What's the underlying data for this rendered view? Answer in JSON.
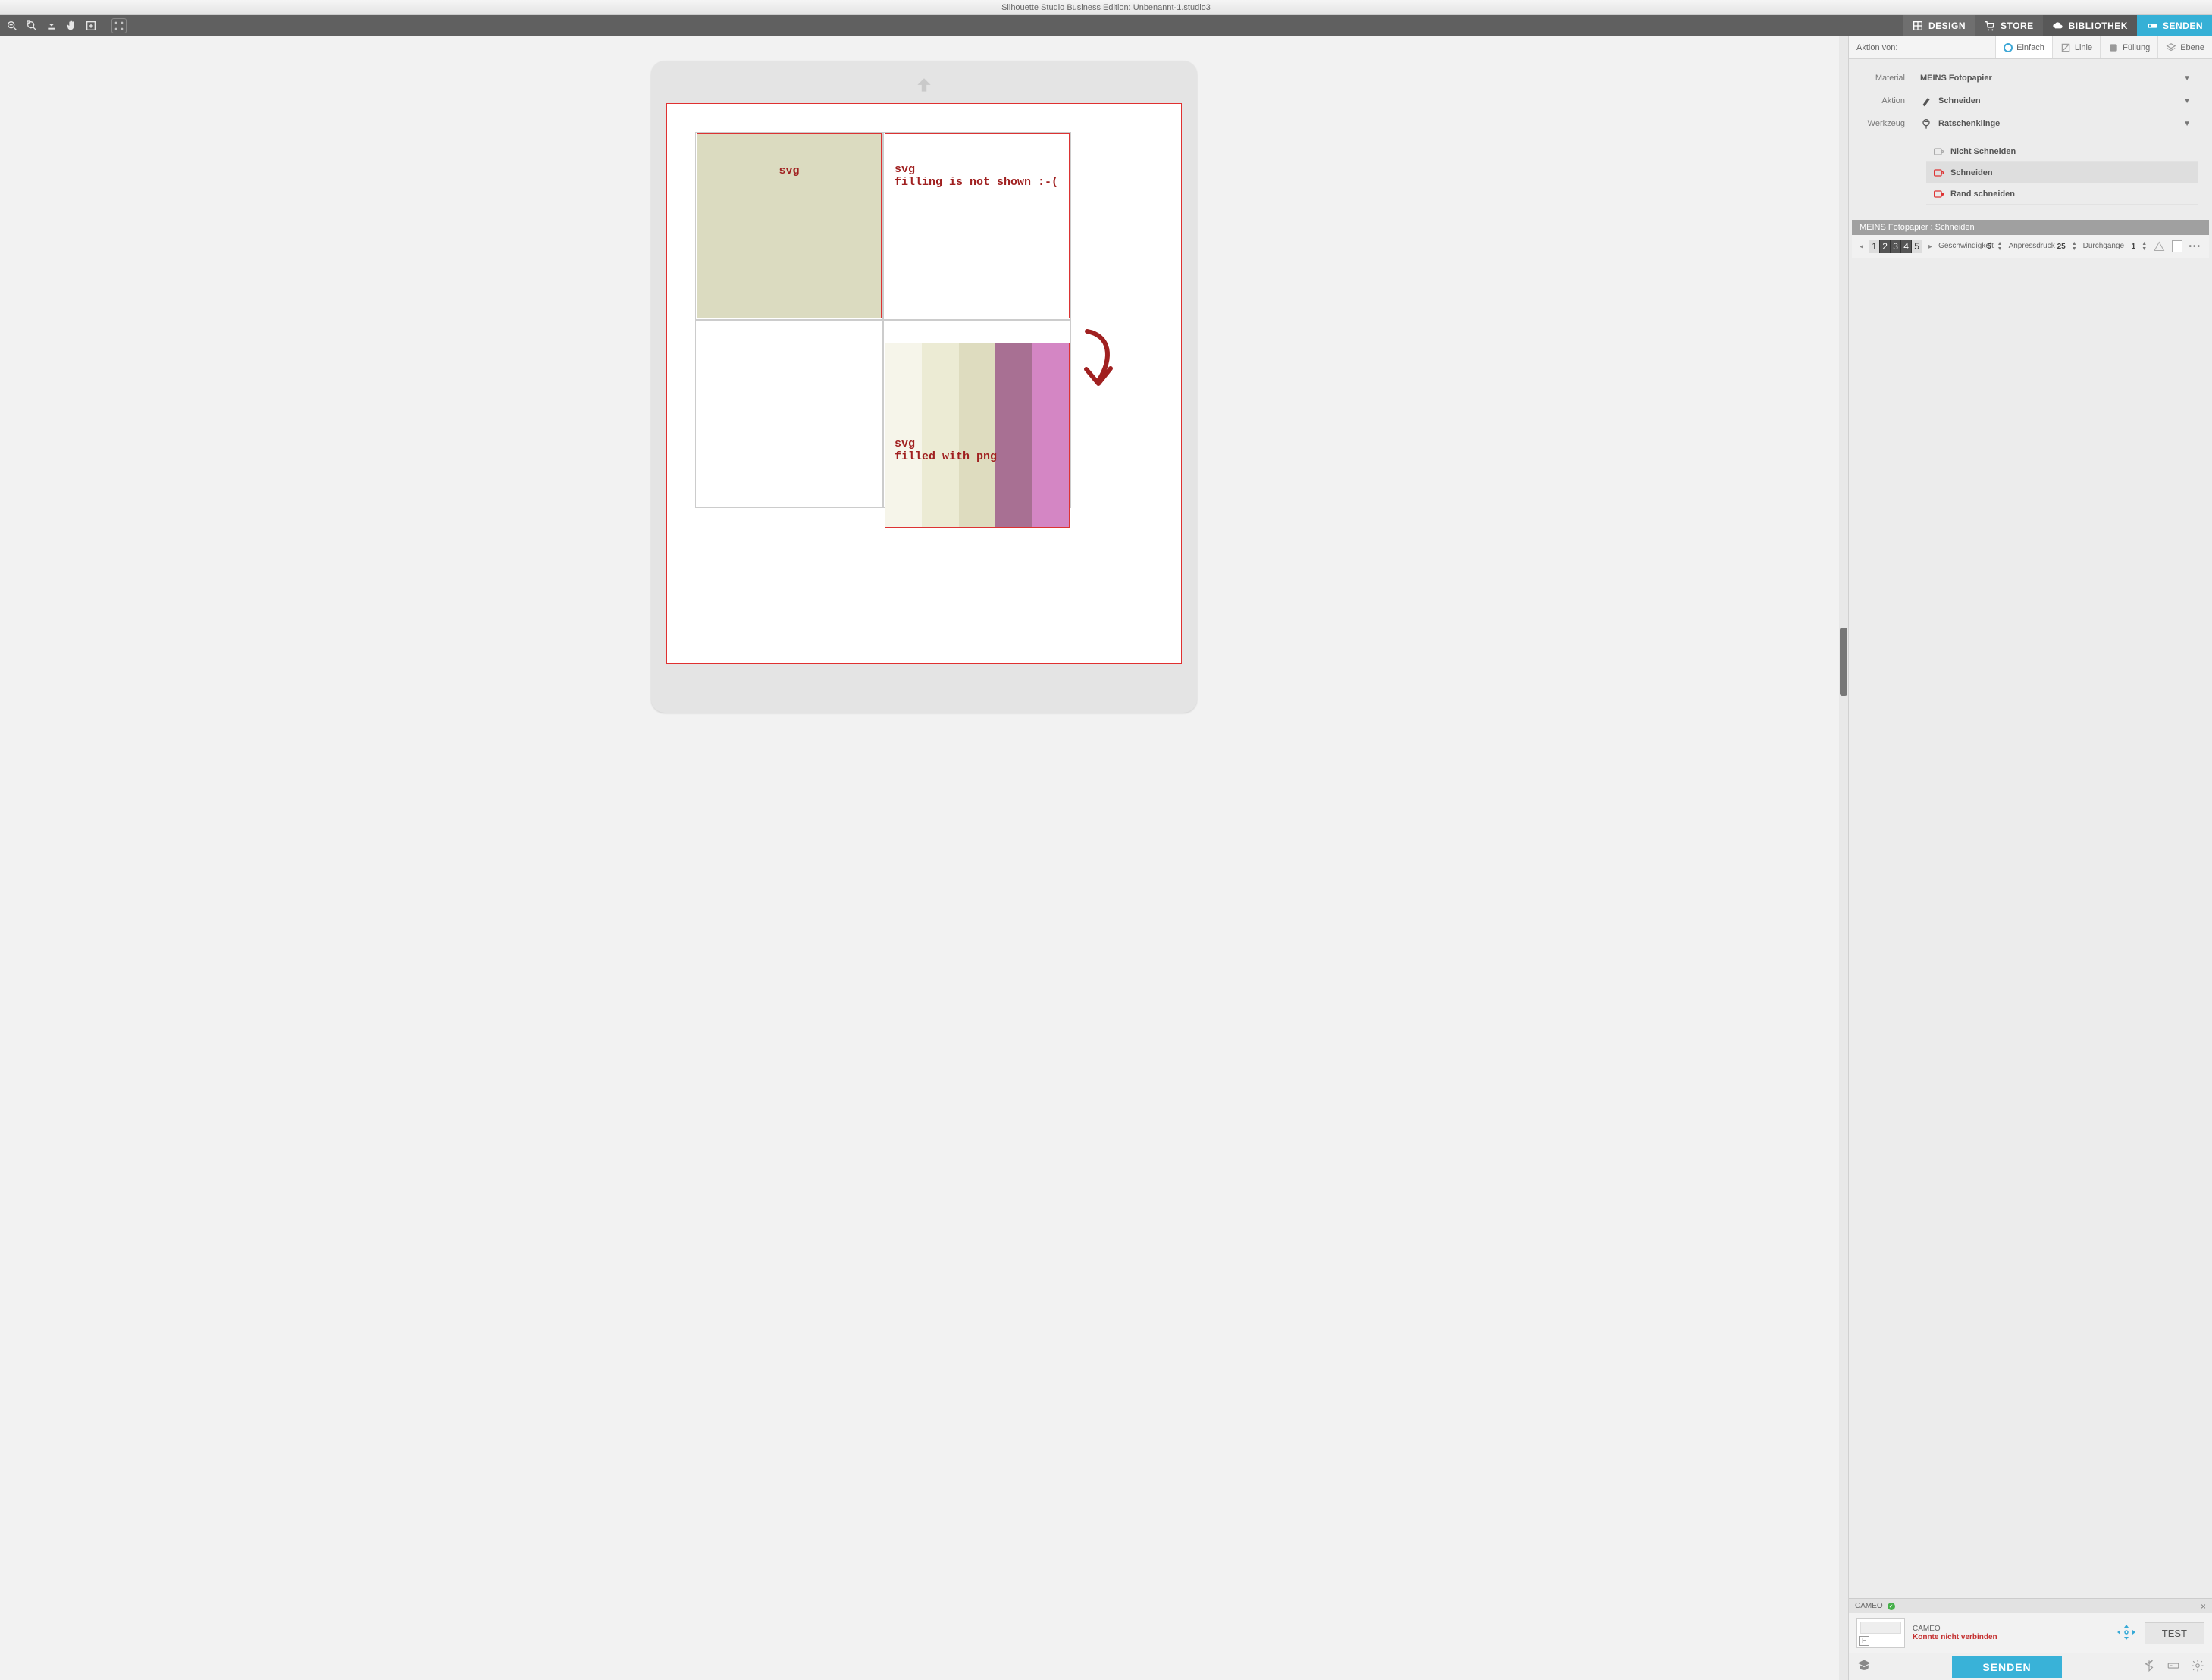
{
  "title": "Silhouette Studio Business Edition: Unbenannt-1.studio3",
  "nav": {
    "design": "DESIGN",
    "store": "STORE",
    "library": "BIBLIOTHEK",
    "send": "SENDEN"
  },
  "canvas": {
    "obj1": "svg",
    "obj2": "svg\nfilling is not shown :-(",
    "obj3": "svg\nfilled with png"
  },
  "panel": {
    "action_from": "Aktion von:",
    "tabs": {
      "simple": "Einfach",
      "line": "Linie",
      "fill": "Füllung",
      "layer": "Ebene"
    },
    "material_label": "Material",
    "material_value": "MEINS Fotopapier",
    "action_label": "Aktion",
    "action_value": "Schneiden",
    "tool_label": "Werkzeug",
    "tool_value": "Ratschenklinge",
    "opts": {
      "nocut": "Nicht Schneiden",
      "cut": "Schneiden",
      "edgecut": "Rand schneiden"
    },
    "section": "MEINS Fotopapier : Schneiden",
    "params": {
      "speed_label": "Geschwindigkeit",
      "speed_value": "5",
      "force_label": "Anpressdruck",
      "force_value": "25",
      "passes_label": "Durchgänge",
      "passes_value": "1"
    }
  },
  "device": {
    "tab": "CAMEO",
    "name": "CAMEO",
    "error": "Konnte nicht verbinden",
    "thumb_letter": "F",
    "test": "TEST"
  },
  "footer": {
    "send": "SENDEN"
  }
}
